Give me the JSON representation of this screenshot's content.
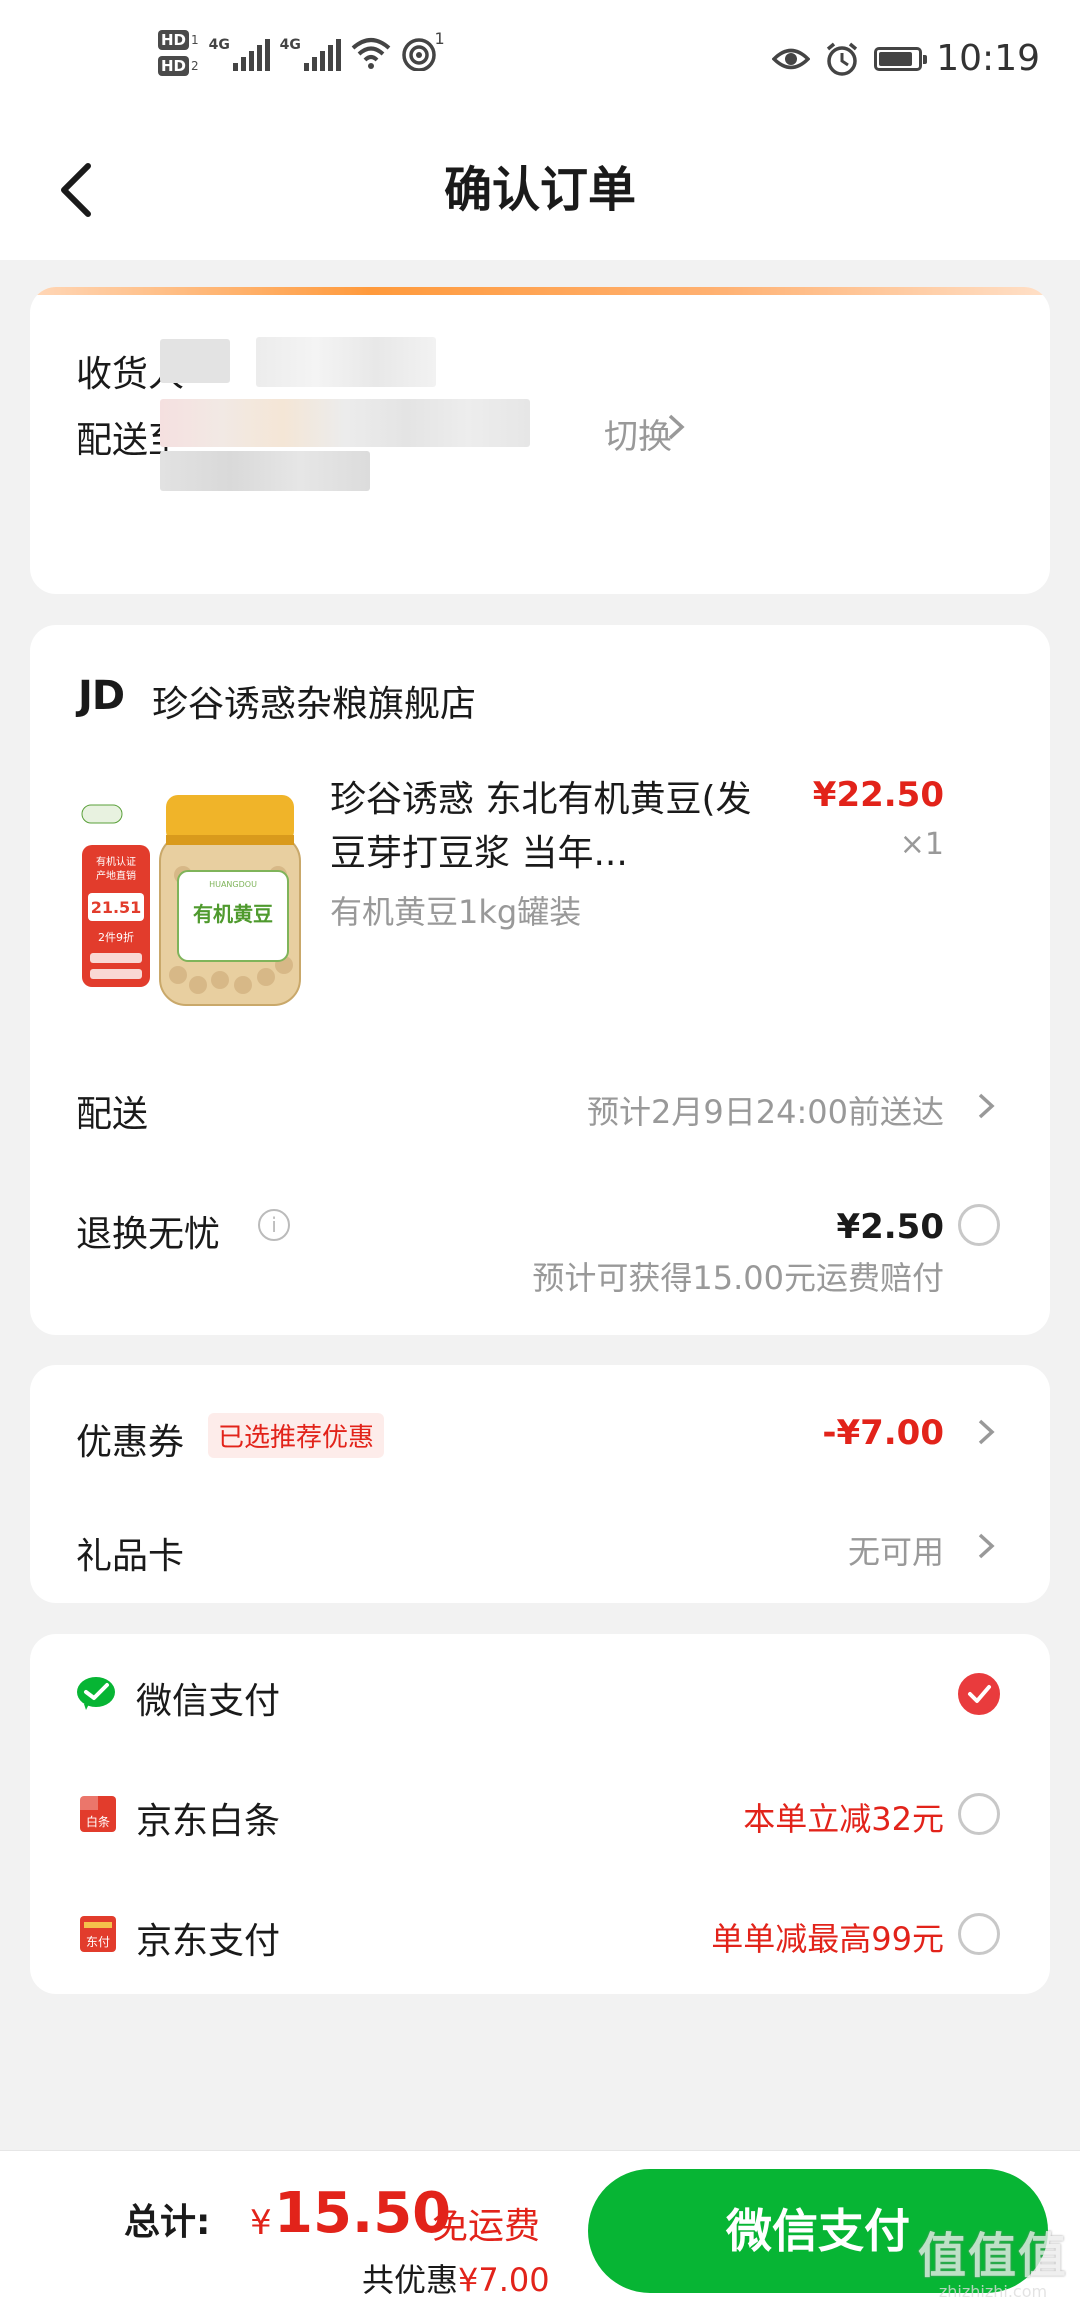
{
  "status_bar": {
    "time": "10:19",
    "sim1_label": "HD",
    "sim1_index": "1",
    "sim2_label": "HD",
    "sim2_index": "2",
    "network1": "4G",
    "network2": "4G",
    "hotspot_count": "1",
    "battery_level": 0.85,
    "icons": [
      "eye-comfort-icon",
      "alarm-icon",
      "battery-icon",
      "wifi-icon",
      "hotspot-icon"
    ]
  },
  "nav": {
    "title": "确认订单",
    "back_icon": "chevron-left-icon"
  },
  "address": {
    "receiver_label": "收货人",
    "ship_to_label": "配送至",
    "switch_label": "切换"
  },
  "order": {
    "store_logo": "JD",
    "store_name": "珍谷诱惑杂粮旗舰店",
    "product": {
      "title": "珍谷诱惑 东北有机黄豆(发豆芽打豆浆 当年...",
      "spec": "有机黄豆1kg罐装",
      "price": "¥22.50",
      "qty": "×1",
      "image_text": [
        "有机认证",
        "产地直销",
        "21.51",
        "2件9折",
        "有机黄豆"
      ]
    },
    "delivery_label": "配送",
    "delivery_value": "预计2月9日24:00前送达",
    "return_label": "退换无忧",
    "return_price": "¥2.50",
    "return_note": "预计可获得15.00元运费赔付"
  },
  "coupon": {
    "label": "优惠券",
    "tag": "已选推荐优惠",
    "value": "-¥7.00",
    "gift_label": "礼品卡",
    "gift_value": "无可用"
  },
  "payment": {
    "methods": [
      {
        "label": "微信支付",
        "note": "",
        "selected": true,
        "icon": "wechat-pay-icon"
      },
      {
        "label": "京东白条",
        "note": "本单立减32元",
        "selected": false,
        "icon": "jd-baitiao-icon"
      },
      {
        "label": "京东支付",
        "note": "单单减最高99元",
        "selected": false,
        "icon": "jd-pay-icon"
      }
    ],
    "baitiao_icon_text": "白条",
    "jdpay_icon_text": "东付"
  },
  "bottom": {
    "total_label": "总计:",
    "currency": "¥",
    "total_amount": "15.50",
    "free_shipping": "免运费",
    "saved_label": "共优惠",
    "saved_amount": "¥7.00",
    "pay_button": "微信支付"
  },
  "watermark": {
    "logo": "值值值",
    "sub": "zhizhizhi.com"
  },
  "colors": {
    "accent_red": "#e2231a",
    "wechat_green": "#07b534",
    "radio_selected": "#e93b3d"
  }
}
